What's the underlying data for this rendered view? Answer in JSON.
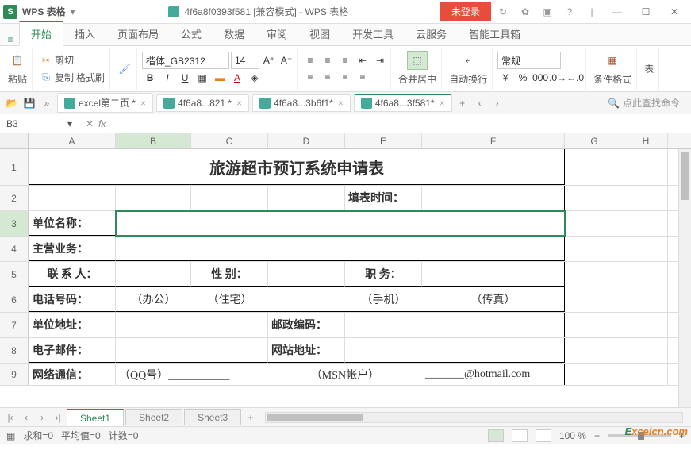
{
  "app": {
    "name": "WPS 表格",
    "doc_title": "4f6a8f0393f581 [兼容模式] - WPS 表格",
    "login": "未登录"
  },
  "menu": {
    "tabs": [
      "开始",
      "插入",
      "页面布局",
      "公式",
      "数据",
      "审阅",
      "视图",
      "开发工具",
      "云服务",
      "智能工具箱"
    ],
    "active": 0
  },
  "ribbon": {
    "paste": "粘贴",
    "cut": "剪切",
    "copy": "复制",
    "format_painter": "格式刷",
    "font_name": "楷体_GB2312",
    "font_size": "14",
    "merge_center": "合并居中",
    "wrap": "自动换行",
    "number_format": "常规",
    "cond_format": "条件格式",
    "table_style": "表"
  },
  "doctabs": {
    "tabs": [
      "excel第二页 *",
      "4f6a8...821 *",
      "4f6a8...3b6f1*",
      "4f6a8...3f581*"
    ],
    "active": 3,
    "search": "点此查找命令"
  },
  "fbar": {
    "cell_ref": "B3",
    "fx": "fx"
  },
  "cols": {
    "labels": [
      "A",
      "B",
      "C",
      "D",
      "E",
      "F",
      "G",
      "H"
    ],
    "widths": [
      110,
      95,
      97,
      97,
      97,
      180,
      75,
      55
    ]
  },
  "rows_meta": {
    "heights": [
      46,
      32,
      32,
      32,
      32,
      32,
      32,
      32,
      28
    ],
    "selected": 3
  },
  "sheet": {
    "title": "旅游超市预订系统申请表",
    "r2_e": "填表时间：",
    "r3_a": "单位名称：",
    "r4_a": "主营业务：",
    "r5_a": "联 系 人：",
    "r5_c": "性    别：",
    "r5_e": "职    务：",
    "r6_a": "电话号码：",
    "r6_b": "（办公）",
    "r6_c": "（住宅）",
    "r6_e": "（手机）",
    "r6_f": "（传真）",
    "r7_a": "单位地址：",
    "r7_d": "邮政编码：",
    "r8_a": "电子邮件：",
    "r8_d": "网站地址：",
    "r9_a": "网络通信：",
    "r9_bc": "（QQ号）___________",
    "r9_de": "（MSN帐户）",
    "r9_f": "_______@hotmail.com"
  },
  "sheets": {
    "tabs": [
      "Sheet1",
      "Sheet2",
      "Sheet3"
    ],
    "active": 0
  },
  "status": {
    "sum": "求和=0",
    "avg": "平均值=0",
    "count": "计数=0",
    "zoom": "100 %"
  },
  "watermark": {
    "e": "E",
    "rest": "xcelcn.com"
  },
  "chart_data": {
    "type": "table",
    "title": "旅游超市预订系统申请表",
    "note": "Spreadsheet application-form layout; no numeric chart data present."
  }
}
